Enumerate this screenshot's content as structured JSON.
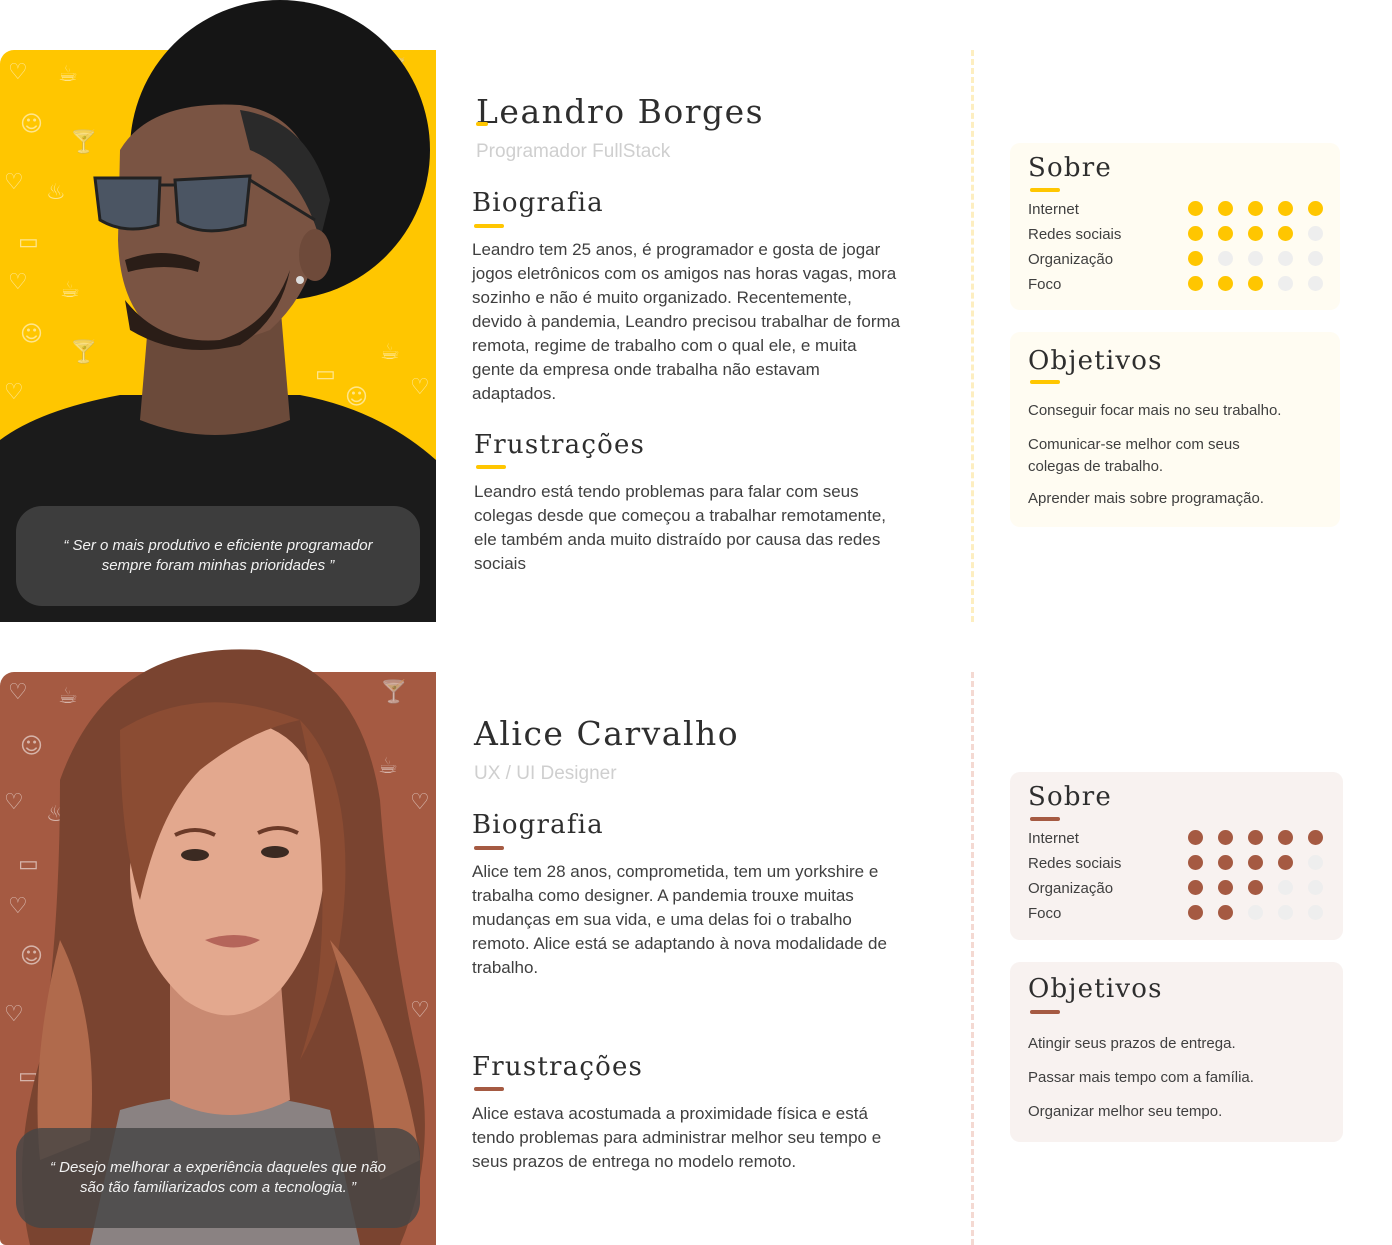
{
  "colors": {
    "yellow": "#ffc600",
    "brown": "#a55a42",
    "dot_empty": "#eeeeee"
  },
  "personas": [
    {
      "name": "Leandro Borges",
      "role": "Programador FullStack",
      "quote": "“ Ser o mais produtivo e eficiente programador sempre foram minhas prioridades ”",
      "bio_title": "Biografia",
      "bio": "Leandro tem 25 anos, é programador e gosta de jogar jogos eletrônicos com os amigos nas horas vagas, mora sozinho e não é muito organizado. Recentemente, devido à pandemia, Leandro precisou trabalhar de forma remota, regime de trabalho com o qual ele, e muita gente da empresa onde trabalha não estavam adaptados.",
      "frust_title": "Frustrações",
      "frust": "Leandro está tendo problemas para falar com seus colegas desde que começou a trabalhar remotamente, ele também anda muito distraído por causa das redes sociais",
      "about_title": "Sobre",
      "skills": [
        {
          "label": "Internet",
          "level": 5
        },
        {
          "label": "Redes sociais",
          "level": 4
        },
        {
          "label": "Organização",
          "level": 1
        },
        {
          "label": "Foco",
          "level": 3
        }
      ],
      "goals_title": "Objetivos",
      "goals": [
        "Conseguir focar mais no seu trabalho.",
        "Comunicar-se melhor com seus colegas de trabalho.",
        "Aprender mais sobre programação."
      ]
    },
    {
      "name": "Alice Carvalho",
      "role": "UX / UI Designer",
      "quote": "“ Desejo melhorar a experiência daqueles que não são tão familiarizados com a tecnologia. ”",
      "bio_title": "Biografia",
      "bio": "Alice tem 28 anos, comprometida, tem um yorkshire e trabalha como designer. A pandemia trouxe muitas mudanças em sua vida, e uma delas foi o trabalho remoto. Alice está se adaptando à nova modalidade de trabalho.",
      "frust_title": "Frustrações",
      "frust": "Alice estava acostumada a proximidade física e está tendo problemas para administrar melhor seu tempo e  seus prazos de entrega no modelo remoto.",
      "about_title": "Sobre",
      "skills": [
        {
          "label": "Internet",
          "level": 5
        },
        {
          "label": "Redes sociais",
          "level": 4
        },
        {
          "label": "Organização",
          "level": 3
        },
        {
          "label": "Foco",
          "level": 2
        }
      ],
      "goals_title": "Objetivos",
      "goals": [
        "Atingir seus prazos de entrega.",
        "Passar mais tempo com a família.",
        "Organizar melhor seu tempo."
      ]
    }
  ]
}
